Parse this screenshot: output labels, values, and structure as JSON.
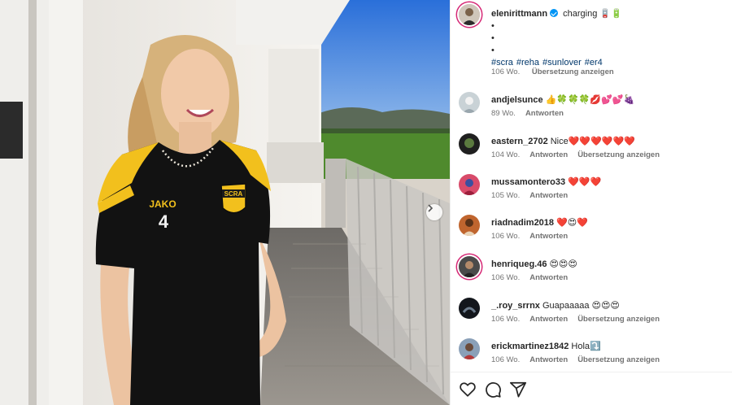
{
  "post": {
    "author": "elenirittmann",
    "caption_text": "charging 🪫🔋",
    "caption_dots": [
      "•",
      "•",
      "•"
    ],
    "hashtags": [
      "#scra",
      "#reha",
      "#sunlover",
      "#er4"
    ],
    "time": "106 Wo.",
    "translate_label": "Übersetzung anzeigen"
  },
  "photo": {
    "jersey_brand": "JAKO",
    "jersey_number": "4",
    "badge_text": "SCRA"
  },
  "comments": [
    {
      "user": "andjelsunce",
      "text": "👍🍀🍀🍀💋💕💕🍇",
      "time": "89 Wo.",
      "reply": "Antworten",
      "translate": ""
    },
    {
      "user": "eastern_2702",
      "text": "Nice❤️❤️❤️❤️❤️❤️",
      "time": "104 Wo.",
      "reply": "Antworten",
      "translate": "Übersetzung anzeigen"
    },
    {
      "user": "mussamontero33",
      "text": "❤️❤️❤️",
      "time": "105 Wo.",
      "reply": "Antworten",
      "translate": ""
    },
    {
      "user": "riadnadim2018",
      "text": "❤️😍❤️",
      "time": "106 Wo.",
      "reply": "Antworten",
      "translate": ""
    },
    {
      "user": "henriqueg.46",
      "text": "😍😍😍",
      "time": "106 Wo.",
      "reply": "Antworten",
      "translate": ""
    },
    {
      "user": "_.roy_srrnx",
      "text": "Guapaaaaa 😍😍😍",
      "time": "106 Wo.",
      "reply": "Antworten",
      "translate": "Übersetzung anzeigen"
    },
    {
      "user": "erickmartinez1842",
      "text": "Hola⤵️",
      "time": "106 Wo.",
      "reply": "Antworten",
      "translate": "Übersetzung anzeigen"
    }
  ],
  "actions": {
    "like_icon": "heart-icon",
    "comment_icon": "comment-icon",
    "share_icon": "share-icon"
  },
  "colors": {
    "accent": "#0095f6",
    "hashtag": "#00376b",
    "muted": "#737373",
    "jersey_yellow": "#f2c01d"
  }
}
